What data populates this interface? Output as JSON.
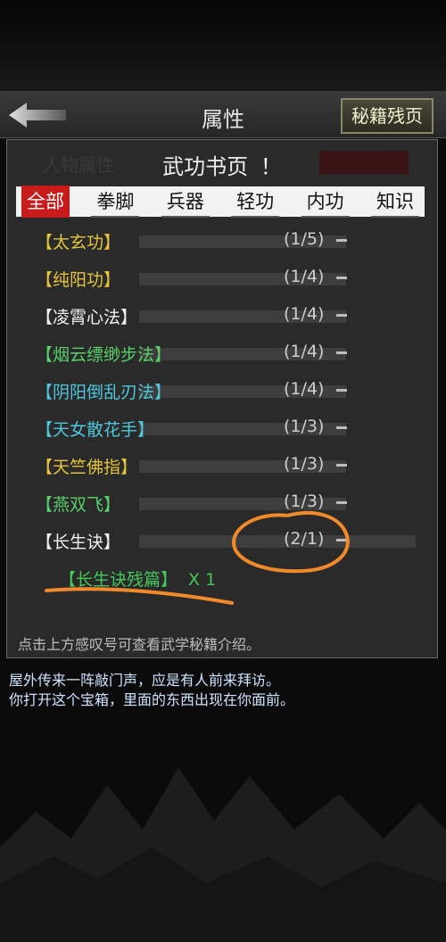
{
  "header": {
    "title": "属性",
    "scroll_button": "秘籍残页"
  },
  "background_text": {
    "tab_people": "人物属性"
  },
  "panel": {
    "title": "武功书页",
    "info_mark": "！"
  },
  "tabs": [
    "全部",
    "拳脚",
    "兵器",
    "轻功",
    "内功",
    "知识"
  ],
  "books": [
    {
      "name": "【太玄功】",
      "count": "(1/5)",
      "color": "yellow"
    },
    {
      "name": "【纯阳功】",
      "count": "(1/4)",
      "color": "yellow"
    },
    {
      "name": "【凌霄心法】",
      "count": "(1/4)",
      "color": "white"
    },
    {
      "name": "【烟云缥缈步法】",
      "count": "(1/4)",
      "color": "green"
    },
    {
      "name": "【阴阳倒乱刃法】",
      "count": "(1/4)",
      "color": "cyan"
    },
    {
      "name": "【天女散花手】",
      "count": "(1/3)",
      "color": "cyan"
    },
    {
      "name": "【天竺佛指】",
      "count": "(1/3)",
      "color": "yellow"
    },
    {
      "name": "【燕双飞】",
      "count": "(1/3)",
      "color": "green"
    },
    {
      "name": "【长生诀】",
      "count": "(2/1)",
      "color": "white"
    }
  ],
  "fragment": {
    "name": "【长生诀残篇】",
    "qty": "X 1"
  },
  "hint": "点击上方感叹号可查看武学秘籍介绍。",
  "story": {
    "line1": "屋外传来一阵敲门声，应是有人前来拜访。",
    "line2": "你打开这个宝箱，里面的东西出现在你面前。"
  },
  "colors": {
    "tab_active": "#c81c1c",
    "annotation": "#f08a2a",
    "yellow": "#e3c43a",
    "green": "#57d06a",
    "cyan": "#4dc8dc"
  }
}
